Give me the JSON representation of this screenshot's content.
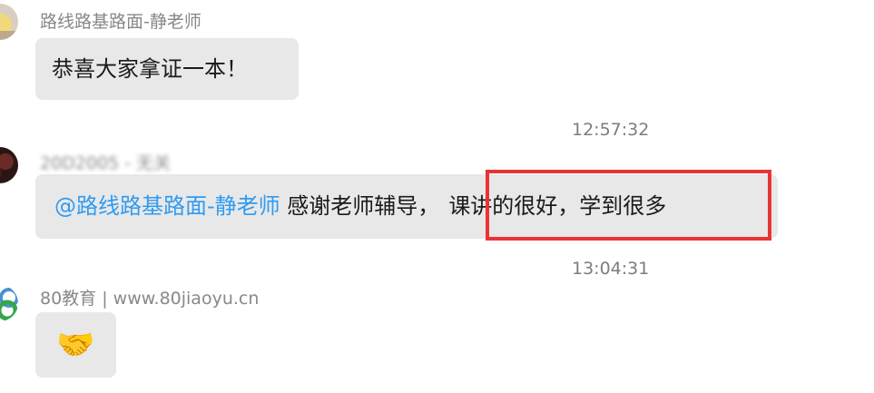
{
  "messages": [
    {
      "sender": "路线路基路面-静老师",
      "text": "恭喜大家拿证一本！"
    },
    {
      "timestamp": "12:57:32",
      "sender": "20D2005 - 无关",
      "mention": "@路线路基路面-静老师",
      "text_part1": " 感谢老师辅导，",
      "text_part2": "课讲的很好，学到很多"
    },
    {
      "timestamp": "13:04:31",
      "sender": "80教育 | www.80jiaoyu.cn",
      "text": "🤝"
    }
  ],
  "colors": {
    "bubble": "#e8e8e8",
    "mention": "#2f9bf2",
    "highlight": "#ea3335",
    "meta_text": "#888888"
  }
}
